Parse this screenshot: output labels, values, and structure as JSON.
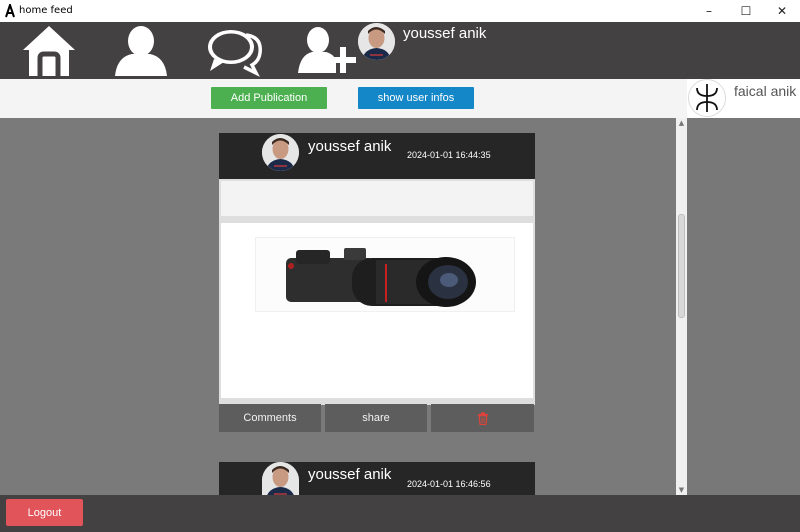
{
  "window": {
    "title": "home feed",
    "minimize_glyph": "–",
    "maximize_glyph": "☐",
    "close_glyph": "✕"
  },
  "nav": {
    "icons": [
      "home-icon",
      "profile-icon",
      "chat-icon",
      "add-friend-icon"
    ],
    "username": "youssef anik"
  },
  "actions": {
    "add_publication": "Add Publication",
    "show_user_infos": "show user infos"
  },
  "sidebar": {
    "friends": [
      {
        "name": "faical anik"
      }
    ]
  },
  "posts": [
    {
      "username": "youssef anik",
      "timestamp": "2024-01-01 16:44:35",
      "comments_label": "Comments",
      "share_label": "share",
      "delete_icon": "trash-icon"
    },
    {
      "username": "youssef anik",
      "timestamp": "2024-01-01 16:46:56"
    }
  ],
  "footer": {
    "logout": "Logout"
  },
  "colors": {
    "nav_bg": "#444142",
    "add_button": "#4cb050",
    "info_button": "#1487c8",
    "logout_button": "#e0545a",
    "feed_bg": "#7a7a7a",
    "post_header": "#262626"
  }
}
